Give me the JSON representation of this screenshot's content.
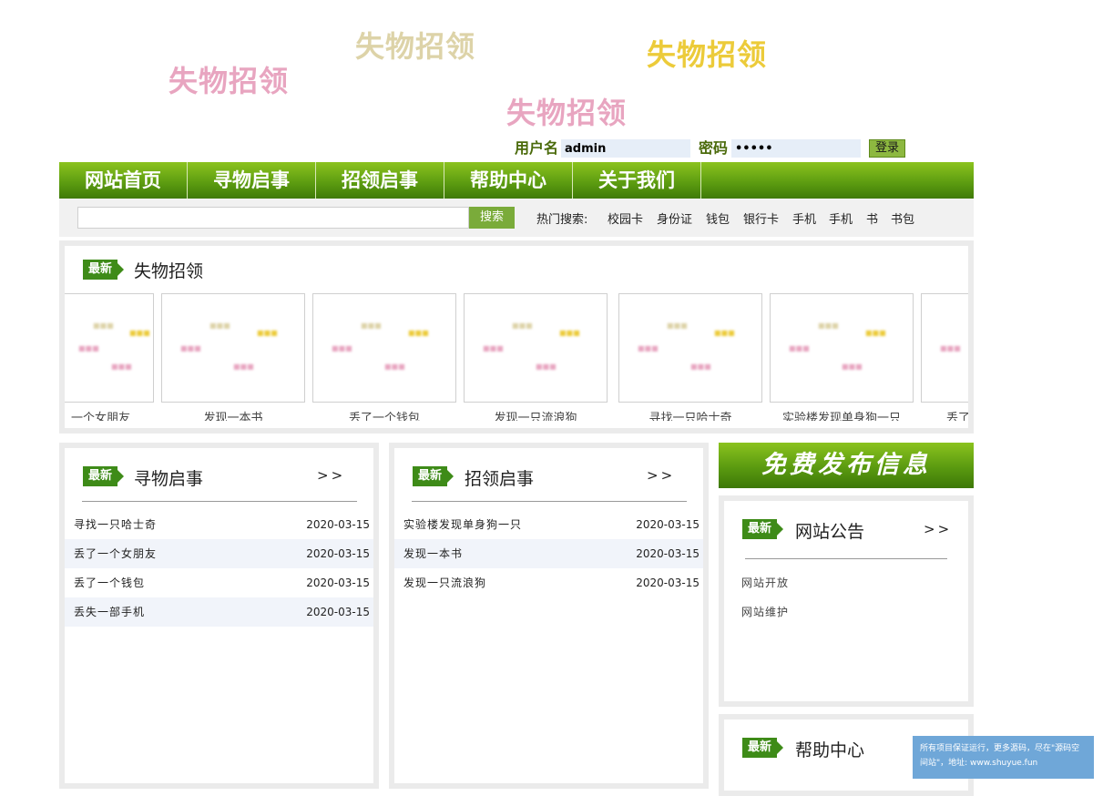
{
  "banner": {
    "watermarks": [
      "失物招领",
      "失物招领",
      "失物招领",
      "失物招领"
    ]
  },
  "login": {
    "username_label": "用户名",
    "username_value": "admin",
    "password_label": "密码",
    "password_value": "•••••",
    "login_button": "登录"
  },
  "nav": {
    "items": [
      "网站首页",
      "寻物启事",
      "招领启事",
      "帮助中心",
      "关于我们"
    ]
  },
  "search": {
    "button": "搜索",
    "hot_label": "热门搜索:",
    "hot_keywords": [
      "校园卡",
      "身份证",
      "钱包",
      "银行卡",
      "手机",
      "手机",
      "书",
      "书包"
    ]
  },
  "badge_label": "最新",
  "latest": {
    "title": "失物招领",
    "cards": [
      "一个女朋友",
      "发现一本书",
      "丢了一个钱包",
      "发现一只流浪狗",
      "寻找一只哈士奇",
      "实验楼发现单身狗一只",
      "丢了"
    ]
  },
  "lost": {
    "title": "寻物启事",
    "more": ">>",
    "rows": [
      {
        "title": "寻找一只哈士奇",
        "date": "2020-03-15"
      },
      {
        "title": "丢了一个女朋友",
        "date": "2020-03-15"
      },
      {
        "title": "丢了一个钱包",
        "date": "2020-03-15"
      },
      {
        "title": "丢失一部手机",
        "date": "2020-03-15"
      }
    ]
  },
  "found": {
    "title": "招领启事",
    "more": ">>",
    "rows": [
      {
        "title": "实验楼发现单身狗一只",
        "date": "2020-03-15"
      },
      {
        "title": "发现一本书",
        "date": "2020-03-15"
      },
      {
        "title": "发现一只流浪狗",
        "date": "2020-03-15"
      }
    ]
  },
  "publish": {
    "label": "免费发布信息"
  },
  "announcements": {
    "title": "网站公告",
    "more": ">>",
    "items": [
      "网站开放",
      "网站维护"
    ]
  },
  "help": {
    "title": "帮助中心"
  },
  "footer_note": "所有项目保证运行，更多源码，尽在\"源码空间站\"，地址: www.shuyue.fun",
  "colors": {
    "nav_green": "#5a9a10",
    "badge_green": "#3e8b18",
    "accent_pink": "#e8a5c0",
    "accent_yellow": "#eccb3a"
  }
}
